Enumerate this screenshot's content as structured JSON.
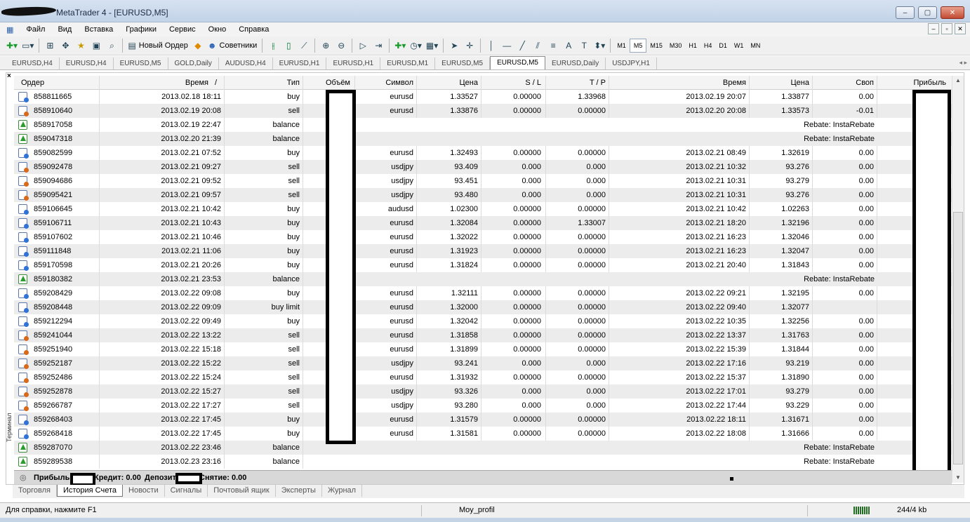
{
  "window": {
    "title": "MetaTrader 4 - [EURUSD,M5]",
    "minimize": "‒",
    "maximize": "▢",
    "close": "✕"
  },
  "menu": [
    "Файл",
    "Вид",
    "Вставка",
    "Графики",
    "Сервис",
    "Окно",
    "Справка"
  ],
  "toolbar": {
    "new_order": "Новый Ордер",
    "experts": "Советники",
    "timeframes": [
      "M1",
      "M5",
      "M15",
      "M30",
      "H1",
      "H4",
      "D1",
      "W1",
      "MN"
    ],
    "active_timeframe": "M5"
  },
  "chart_tabs": [
    "EURUSD,H4",
    "EURUSD,H4",
    "EURUSD,M5",
    "GOLD,Daily",
    "AUDUSD,H4",
    "EURUSD,H1",
    "EURUSD,H1",
    "EURUSD,M1",
    "EURUSD,M5",
    "EURUSD,M5",
    "EURUSD,Daily",
    "USDJPY,H1"
  ],
  "active_chart_tab": 9,
  "table": {
    "headers": {
      "order": "Ордер",
      "time": "Время",
      "sort": "/",
      "type": "Тип",
      "volume": "Объём",
      "symbol": "Символ",
      "price": "Цена",
      "sl": "S / L",
      "tp": "T / P",
      "close_time": "Время",
      "close_price": "Цена",
      "swap": "Своп",
      "profit": "Прибыль"
    },
    "rows": [
      {
        "icon": "buy",
        "order": "858811665",
        "time": "2013.02.18 18:11",
        "type": "buy",
        "symbol": "eurusd",
        "price": "1.33527",
        "sl": "0.00000",
        "tp": "1.33968",
        "close_time": "2013.02.19 20:07",
        "close_price": "1.33877",
        "swap": "0.00",
        "comment": ""
      },
      {
        "icon": "sell",
        "order": "858910640",
        "time": "2013.02.19 20:08",
        "type": "sell",
        "symbol": "eurusd",
        "price": "1.33876",
        "sl": "0.00000",
        "tp": "0.00000",
        "close_time": "2013.02.20 20:08",
        "close_price": "1.33573",
        "swap": "-0.01",
        "comment": ""
      },
      {
        "icon": "balance",
        "order": "858917058",
        "time": "2013.02.19 22:47",
        "type": "balance",
        "symbol": "",
        "price": "",
        "sl": "",
        "tp": "",
        "close_time": "",
        "close_price": "",
        "swap": "",
        "comment": "Rebate: InstaRebate"
      },
      {
        "icon": "balance",
        "order": "859047318",
        "time": "2013.02.20 21:39",
        "type": "balance",
        "symbol": "",
        "price": "",
        "sl": "",
        "tp": "",
        "close_time": "",
        "close_price": "",
        "swap": "",
        "comment": "Rebate: InstaRebate"
      },
      {
        "icon": "buy",
        "order": "859082599",
        "time": "2013.02.21 07:52",
        "type": "buy",
        "symbol": "eurusd",
        "price": "1.32493",
        "sl": "0.00000",
        "tp": "0.00000",
        "close_time": "2013.02.21 08:49",
        "close_price": "1.32619",
        "swap": "0.00",
        "comment": ""
      },
      {
        "icon": "sell",
        "order": "859092478",
        "time": "2013.02.21 09:27",
        "type": "sell",
        "symbol": "usdjpy",
        "price": "93.409",
        "sl": "0.000",
        "tp": "0.000",
        "close_time": "2013.02.21 10:32",
        "close_price": "93.276",
        "swap": "0.00",
        "comment": ""
      },
      {
        "icon": "sell",
        "order": "859094686",
        "time": "2013.02.21 09:52",
        "type": "sell",
        "symbol": "usdjpy",
        "price": "93.451",
        "sl": "0.000",
        "tp": "0.000",
        "close_time": "2013.02.21 10:31",
        "close_price": "93.279",
        "swap": "0.00",
        "comment": ""
      },
      {
        "icon": "sell",
        "order": "859095421",
        "time": "2013.02.21 09:57",
        "type": "sell",
        "symbol": "usdjpy",
        "price": "93.480",
        "sl": "0.000",
        "tp": "0.000",
        "close_time": "2013.02.21 10:31",
        "close_price": "93.276",
        "swap": "0.00",
        "comment": ""
      },
      {
        "icon": "buy",
        "order": "859106645",
        "time": "2013.02.21 10:42",
        "type": "buy",
        "symbol": "audusd",
        "price": "1.02300",
        "sl": "0.00000",
        "tp": "0.00000",
        "close_time": "2013.02.21 10:42",
        "close_price": "1.02263",
        "swap": "0.00",
        "comment": ""
      },
      {
        "icon": "buy",
        "order": "859106711",
        "time": "2013.02.21 10:43",
        "type": "buy",
        "symbol": "eurusd",
        "price": "1.32084",
        "sl": "0.00000",
        "tp": "1.33007",
        "close_time": "2013.02.21 18:20",
        "close_price": "1.32196",
        "swap": "0.00",
        "comment": ""
      },
      {
        "icon": "buy",
        "order": "859107602",
        "time": "2013.02.21 10:46",
        "type": "buy",
        "symbol": "eurusd",
        "price": "1.32022",
        "sl": "0.00000",
        "tp": "0.00000",
        "close_time": "2013.02.21 16:23",
        "close_price": "1.32046",
        "swap": "0.00",
        "comment": ""
      },
      {
        "icon": "buy",
        "order": "859111848",
        "time": "2013.02.21 11:06",
        "type": "buy",
        "symbol": "eurusd",
        "price": "1.31923",
        "sl": "0.00000",
        "tp": "0.00000",
        "close_time": "2013.02.21 16:23",
        "close_price": "1.32047",
        "swap": "0.00",
        "comment": ""
      },
      {
        "icon": "buy",
        "order": "859170598",
        "time": "2013.02.21 20:26",
        "type": "buy",
        "symbol": "eurusd",
        "price": "1.31824",
        "sl": "0.00000",
        "tp": "0.00000",
        "close_time": "2013.02.21 20:40",
        "close_price": "1.31843",
        "swap": "0.00",
        "comment": ""
      },
      {
        "icon": "balance",
        "order": "859180382",
        "time": "2013.02.21 23:53",
        "type": "balance",
        "symbol": "",
        "price": "",
        "sl": "",
        "tp": "",
        "close_time": "",
        "close_price": "",
        "swap": "",
        "comment": "Rebate: InstaRebate"
      },
      {
        "icon": "buy",
        "order": "859208429",
        "time": "2013.02.22 09:08",
        "type": "buy",
        "symbol": "eurusd",
        "price": "1.32111",
        "sl": "0.00000",
        "tp": "0.00000",
        "close_time": "2013.02.22 09:21",
        "close_price": "1.32195",
        "swap": "0.00",
        "comment": ""
      },
      {
        "icon": "buy",
        "order": "859208448",
        "time": "2013.02.22 09:09",
        "type": "buy limit",
        "symbol": "eurusd",
        "price": "1.32000",
        "sl": "0.00000",
        "tp": "0.00000",
        "close_time": "2013.02.22 09:40",
        "close_price": "1.32077",
        "swap": "",
        "comment": ""
      },
      {
        "icon": "buy",
        "order": "859212294",
        "time": "2013.02.22 09:49",
        "type": "buy",
        "symbol": "eurusd",
        "price": "1.32042",
        "sl": "0.00000",
        "tp": "0.00000",
        "close_time": "2013.02.22 10:35",
        "close_price": "1.32256",
        "swap": "0.00",
        "comment": ""
      },
      {
        "icon": "sell",
        "order": "859241044",
        "time": "2013.02.22 13:22",
        "type": "sell",
        "symbol": "eurusd",
        "price": "1.31858",
        "sl": "0.00000",
        "tp": "0.00000",
        "close_time": "2013.02.22 13:37",
        "close_price": "1.31763",
        "swap": "0.00",
        "comment": ""
      },
      {
        "icon": "sell",
        "order": "859251940",
        "time": "2013.02.22 15:18",
        "type": "sell",
        "symbol": "eurusd",
        "price": "1.31899",
        "sl": "0.00000",
        "tp": "0.00000",
        "close_time": "2013.02.22 15:39",
        "close_price": "1.31844",
        "swap": "0.00",
        "comment": ""
      },
      {
        "icon": "sell",
        "order": "859252187",
        "time": "2013.02.22 15:22",
        "type": "sell",
        "symbol": "usdjpy",
        "price": "93.241",
        "sl": "0.000",
        "tp": "0.000",
        "close_time": "2013.02.22 17:16",
        "close_price": "93.219",
        "swap": "0.00",
        "comment": ""
      },
      {
        "icon": "sell",
        "order": "859252486",
        "time": "2013.02.22 15:24",
        "type": "sell",
        "symbol": "eurusd",
        "price": "1.31932",
        "sl": "0.00000",
        "tp": "0.00000",
        "close_time": "2013.02.22 15:37",
        "close_price": "1.31890",
        "swap": "0.00",
        "comment": ""
      },
      {
        "icon": "sell",
        "order": "859252878",
        "time": "2013.02.22 15:27",
        "type": "sell",
        "symbol": "usdjpy",
        "price": "93.326",
        "sl": "0.000",
        "tp": "0.000",
        "close_time": "2013.02.22 17:01",
        "close_price": "93.279",
        "swap": "0.00",
        "comment": ""
      },
      {
        "icon": "sell",
        "order": "859266787",
        "time": "2013.02.22 17:27",
        "type": "sell",
        "symbol": "usdjpy",
        "price": "93.280",
        "sl": "0.000",
        "tp": "0.000",
        "close_time": "2013.02.22 17:44",
        "close_price": "93.229",
        "swap": "0.00",
        "comment": ""
      },
      {
        "icon": "buy",
        "order": "859268403",
        "time": "2013.02.22 17:45",
        "type": "buy",
        "symbol": "eurusd",
        "price": "1.31579",
        "sl": "0.00000",
        "tp": "0.00000",
        "close_time": "2013.02.22 18:11",
        "close_price": "1.31671",
        "swap": "0.00",
        "comment": ""
      },
      {
        "icon": "buy",
        "order": "859268418",
        "time": "2013.02.22 17:45",
        "type": "buy",
        "symbol": "eurusd",
        "price": "1.31581",
        "sl": "0.00000",
        "tp": "0.00000",
        "close_time": "2013.02.22 18:08",
        "close_price": "1.31666",
        "swap": "0.00",
        "comment": ""
      },
      {
        "icon": "balance",
        "order": "859287070",
        "time": "2013.02.22 23:46",
        "type": "balance",
        "symbol": "",
        "price": "",
        "sl": "",
        "tp": "",
        "close_time": "",
        "close_price": "",
        "swap": "",
        "comment": "Rebate: InstaRebate"
      },
      {
        "icon": "balance",
        "order": "859289538",
        "time": "2013.02.23 23:16",
        "type": "balance",
        "symbol": "",
        "price": "",
        "sl": "",
        "tp": "",
        "close_time": "",
        "close_price": "",
        "swap": "",
        "comment": "Rebate: InstaRebate"
      }
    ]
  },
  "summary": {
    "profit_label": "Прибыль",
    "credit": "Кредит: 0.00",
    "deposit_label": "Депозит",
    "withdrawal": "Снятие: 0.00"
  },
  "terminal_label": "Терминал",
  "bottom_tabs": [
    "Торговля",
    "История Счета",
    "Новости",
    "Сигналы",
    "Почтовый ящик",
    "Эксперты",
    "Журнал"
  ],
  "active_bottom_tab": 1,
  "status": {
    "help": "Для справки, нажмите F1",
    "profile": "Moy_profil",
    "traffic": "244/4 kb"
  },
  "colors": {
    "buy": "#2f72d8",
    "sell": "#d86a1a",
    "balance": "#2a9d2a"
  }
}
